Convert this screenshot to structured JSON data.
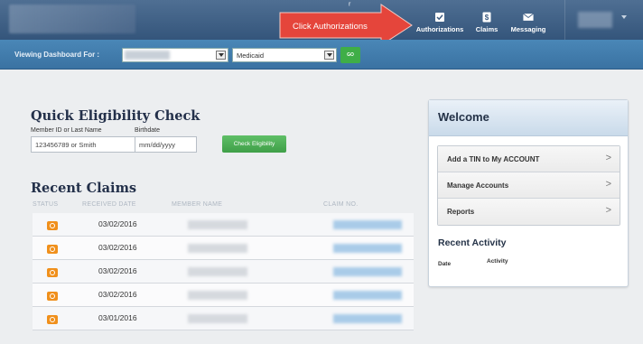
{
  "header": {
    "nav": [
      {
        "label": "Authorizations",
        "icon": "checkbox-icon"
      },
      {
        "label": "Claims",
        "icon": "dollar-doc-icon"
      },
      {
        "label": "Messaging",
        "icon": "envelope-icon"
      }
    ],
    "callout_text": "Click Authorizations",
    "callout_color": "#e5453b"
  },
  "subbar": {
    "label": "Viewing Dashboard For :",
    "plan_value": "Medicaid",
    "go_label": "GO"
  },
  "quick_eligibility": {
    "title": "Quick Eligibility Check",
    "member_label": "Member ID or Last Name",
    "member_placeholder": "123456789 or Smith",
    "birthdate_label": "Birthdate",
    "birthdate_placeholder": "mm/dd/yyyy",
    "button_label": "Check Eligibility"
  },
  "recent_claims": {
    "title": "Recent Claims",
    "columns": [
      "STATUS",
      "RECEIVED DATE",
      "MEMBER NAME",
      "CLAIM NO."
    ],
    "rows": [
      {
        "date": "03/02/2016"
      },
      {
        "date": "03/02/2016"
      },
      {
        "date": "03/02/2016"
      },
      {
        "date": "03/02/2016"
      },
      {
        "date": "03/01/2016"
      }
    ]
  },
  "welcome": {
    "title": "Welcome",
    "menu": [
      {
        "label": "Add a TIN to My ACCOUNT"
      },
      {
        "label": "Manage Accounts"
      },
      {
        "label": "Reports"
      }
    ],
    "chevron": ">",
    "recent_activity_title": "Recent Activity",
    "activity_columns": [
      "Date",
      "Activity"
    ]
  },
  "colors": {
    "header": "#34557b",
    "subbar": "#3a72a2",
    "accent_green": "#3fae47",
    "status_orange": "#f0901c"
  }
}
